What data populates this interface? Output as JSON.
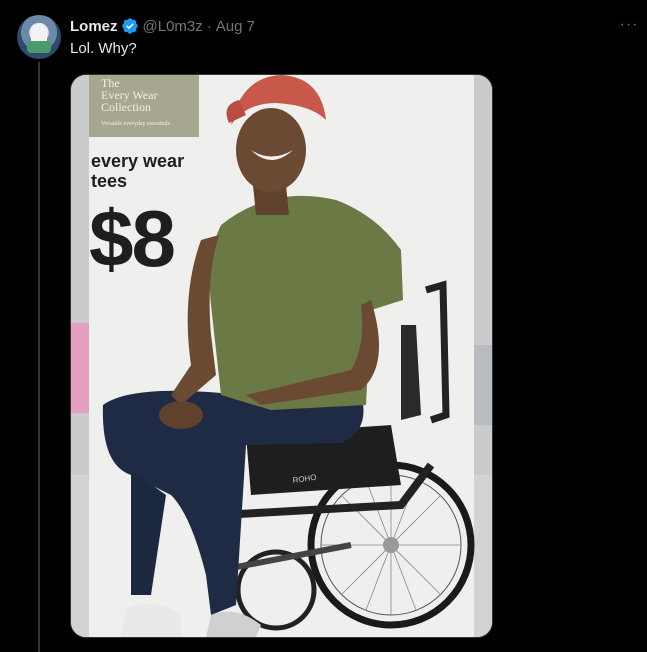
{
  "tweet": {
    "author_name": "Lomez",
    "handle": "@L0m3z",
    "separator": "·",
    "date": "Aug 7",
    "text": "Lol. Why?",
    "more_label": "···"
  },
  "image": {
    "collection_lines": [
      "The",
      "Every Wear",
      "Collection",
      "Versatile everyday essentials"
    ],
    "promo_line1": "every wear",
    "promo_line2": "tees",
    "price": "$8",
    "brand_on_chair": "ROHO",
    "description": "Store sign showing a smiling man in a green t-shirt, red cap and jeans seated in a wheelchair"
  },
  "colors": {
    "background": "#000000",
    "text": "#e7e9ea",
    "muted": "#71767b",
    "verified": "#1d9bf0",
    "shirt": "#6b7a45",
    "cap": "#c8584a"
  }
}
